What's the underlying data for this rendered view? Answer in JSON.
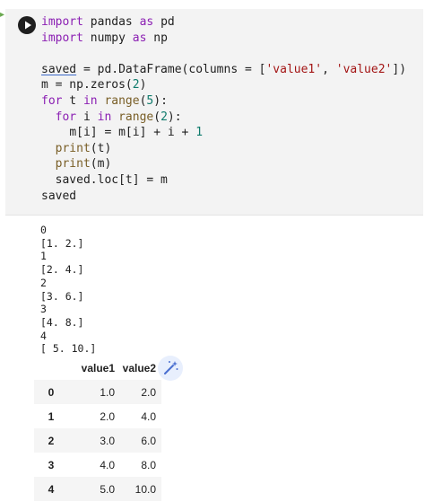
{
  "code_cell": {
    "run_button_icon": "play-icon",
    "lines": {
      "l1": {
        "kw1": "import",
        "t1": " pandas ",
        "kw2": "as",
        "t2": " pd"
      },
      "l2": {
        "kw1": "import",
        "t1": " numpy ",
        "kw2": "as",
        "t2": " np"
      },
      "l4": {
        "var": "saved",
        "t1": " = pd.DataFrame(columns = [",
        "s1": "'value1'",
        "t2": ", ",
        "s2": "'value2'",
        "t3": "])"
      },
      "l5": {
        "t1": "m = np.zeros(",
        "n1": "2",
        "t2": ")"
      },
      "l6": {
        "kw1": "for",
        "t1": " t ",
        "kw2": "in",
        "fn1": " range",
        "t2": "(",
        "n1": "5",
        "t3": "):"
      },
      "l7": {
        "indent": "  ",
        "kw1": "for",
        "t1": " i ",
        "kw2": "in",
        "fn1": " range",
        "t2": "(",
        "n1": "2",
        "t3": "):"
      },
      "l8": {
        "indent": "    ",
        "t1": "m[i] = m[i] + i + ",
        "n1": "1"
      },
      "l9": {
        "indent": "  ",
        "fn1": "print",
        "t1": "(t)"
      },
      "l10": {
        "indent": "  ",
        "fn1": "print",
        "t1": "(m)"
      },
      "l11": {
        "indent": "  ",
        "t1": "saved.loc[t] = m"
      },
      "l12": {
        "t1": "saved"
      }
    }
  },
  "output": {
    "stdout": "0\n[1. 2.]\n1\n[2. 4.]\n2\n[3. 6.]\n3\n[4. 8.]\n4\n[ 5. 10.]"
  },
  "dataframe": {
    "columns": [
      "value1",
      "value2"
    ],
    "rows": [
      {
        "index": "0",
        "value1": "1.0",
        "value2": "2.0"
      },
      {
        "index": "1",
        "value1": "2.0",
        "value2": "4.0"
      },
      {
        "index": "2",
        "value1": "3.0",
        "value2": "6.0"
      },
      {
        "index": "3",
        "value1": "4.0",
        "value2": "8.0"
      },
      {
        "index": "4",
        "value1": "5.0",
        "value2": "10.0"
      }
    ],
    "magic_button_icon": "magic-wand-icon"
  }
}
